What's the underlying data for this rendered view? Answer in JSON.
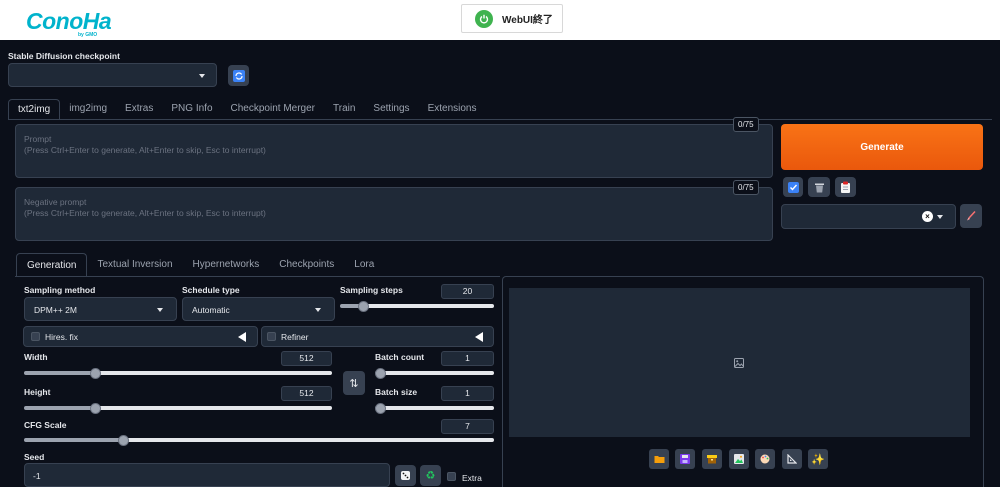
{
  "header": {
    "logo_text": "ConoHa",
    "logo_sub": "by GMO",
    "end_button_label": "WebUI終了"
  },
  "checkpoint": {
    "label": "Stable Diffusion checkpoint",
    "value": ""
  },
  "main_tabs": [
    {
      "label": "txt2img",
      "active": true
    },
    {
      "label": "img2img"
    },
    {
      "label": "Extras"
    },
    {
      "label": "PNG Info"
    },
    {
      "label": "Checkpoint Merger"
    },
    {
      "label": "Train"
    },
    {
      "label": "Settings"
    },
    {
      "label": "Extensions"
    }
  ],
  "prompt": {
    "placeholder_line1": "Prompt",
    "placeholder_line2": "(Press Ctrl+Enter to generate, Alt+Enter to skip, Esc to interrupt)",
    "counter": "0/75"
  },
  "negative_prompt": {
    "placeholder_line1": "Negative prompt",
    "placeholder_line2": "(Press Ctrl+Enter to generate, Alt+Enter to skip, Esc to interrupt)",
    "counter": "0/75"
  },
  "generate_label": "Generate",
  "sub_tabs": [
    {
      "label": "Generation",
      "active": true
    },
    {
      "label": "Textual Inversion"
    },
    {
      "label": "Hypernetworks"
    },
    {
      "label": "Checkpoints"
    },
    {
      "label": "Lora"
    }
  ],
  "params": {
    "sampling_method": {
      "label": "Sampling method",
      "value": "DPM++ 2M"
    },
    "schedule_type": {
      "label": "Schedule type",
      "value": "Automatic"
    },
    "sampling_steps": {
      "label": "Sampling steps",
      "value": "20"
    },
    "hires_fix": {
      "label": "Hires. fix"
    },
    "refiner": {
      "label": "Refiner"
    },
    "width": {
      "label": "Width",
      "value": "512"
    },
    "height": {
      "label": "Height",
      "value": "512"
    },
    "batch_count": {
      "label": "Batch count",
      "value": "1"
    },
    "batch_size": {
      "label": "Batch size",
      "value": "1"
    },
    "cfg_scale": {
      "label": "CFG Scale",
      "value": "7"
    },
    "seed": {
      "label": "Seed",
      "value": "-1"
    },
    "extra": {
      "label": "Extra"
    }
  },
  "colors": {
    "accent": "#ea580c",
    "background": "#0b0f19",
    "panel": "#1f2937",
    "brand": "#00b3cc"
  }
}
